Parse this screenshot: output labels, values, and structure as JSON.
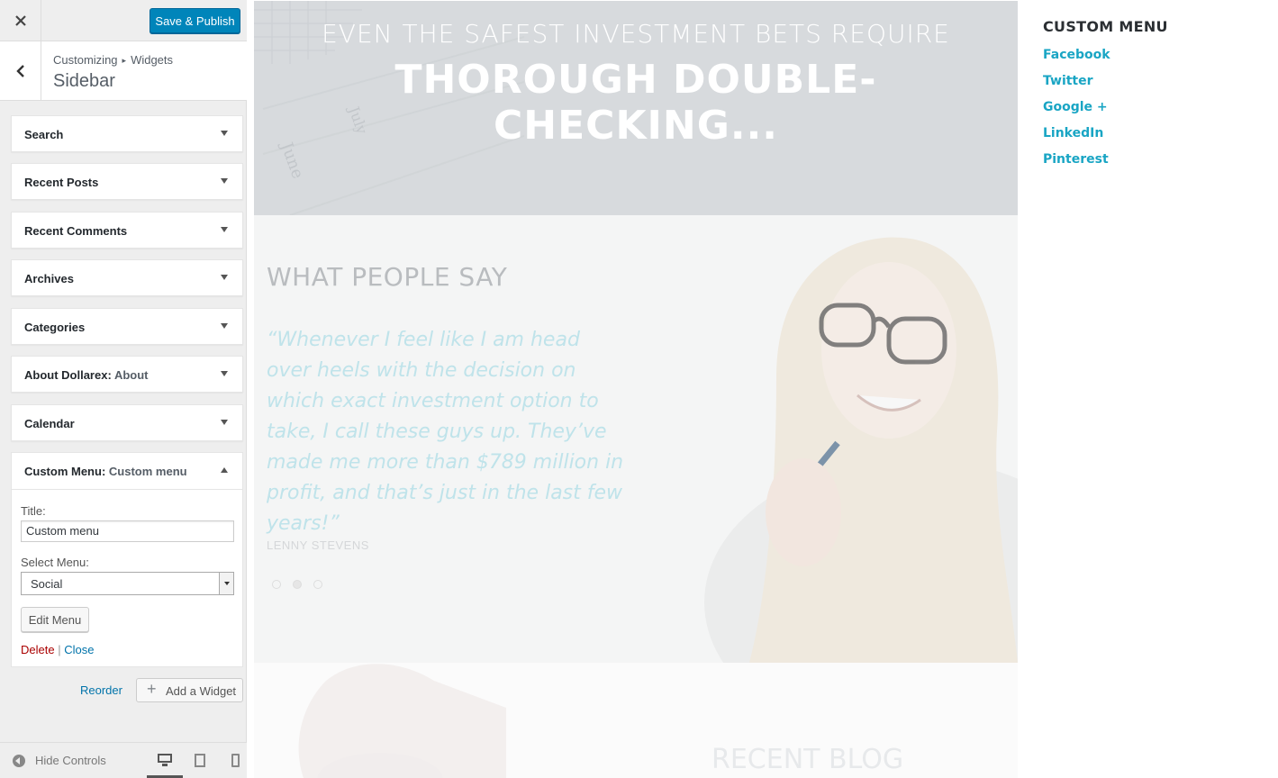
{
  "customizer": {
    "close_icon": "close-icon",
    "save_label": "Save & Publish",
    "breadcrumb": {
      "root": "Customizing",
      "current": "Widgets"
    },
    "section_title": "Sidebar",
    "colors": {
      "primary": "#0085ba",
      "link": "#0073aa",
      "delete": "#a00000"
    }
  },
  "widgets": [
    {
      "title": "Search",
      "instance": ""
    },
    {
      "title": "Recent Posts",
      "instance": ""
    },
    {
      "title": "Recent Comments",
      "instance": ""
    },
    {
      "title": "Archives",
      "instance": ""
    },
    {
      "title": "Categories",
      "instance": ""
    },
    {
      "title": "About Dollarex:",
      "instance": "About"
    },
    {
      "title": "Calendar",
      "instance": ""
    }
  ],
  "open_widget": {
    "title": "Custom Menu:",
    "instance": "Custom menu",
    "title_label": "Title:",
    "title_value": "Custom menu",
    "select_label": "Select Menu:",
    "select_value": "Social",
    "edit_menu_label": "Edit Menu",
    "delete_label": "Delete",
    "separator": "|",
    "close_label": "Close"
  },
  "footer_actions": {
    "reorder_label": "Reorder",
    "add_widget_label": "Add a Widget"
  },
  "footer": {
    "hide_controls_label": "Hide Controls",
    "devices": [
      "desktop-icon",
      "tablet-icon",
      "mobile-icon"
    ],
    "active_device": "desktop"
  },
  "preview": {
    "hero": {
      "subtitle": "EVEN THE SAFEST INVESTMENT BETS REQUIRE",
      "title": "THOROUGH DOUBLE-CHECKING..."
    },
    "testimonials": {
      "heading": "WHAT PEOPLE SAY",
      "quote": "“Whenever I feel like I am head over heels with the decision on which exact investment option to take, I call these guys up. They’ve made me more than $789 million in profit, and that’s just in the last few years!”",
      "author": "LENNY STEVENS",
      "slide_count": 3,
      "active_slide": 2
    },
    "blog_heading": "RECENT BLOG ENTRIES",
    "sidebar_menu": {
      "heading": "CUSTOM MENU",
      "items": [
        "Facebook",
        "Twitter",
        "Google +",
        "LinkedIn",
        "Pinterest"
      ],
      "link_color": "#19a5c4"
    }
  }
}
